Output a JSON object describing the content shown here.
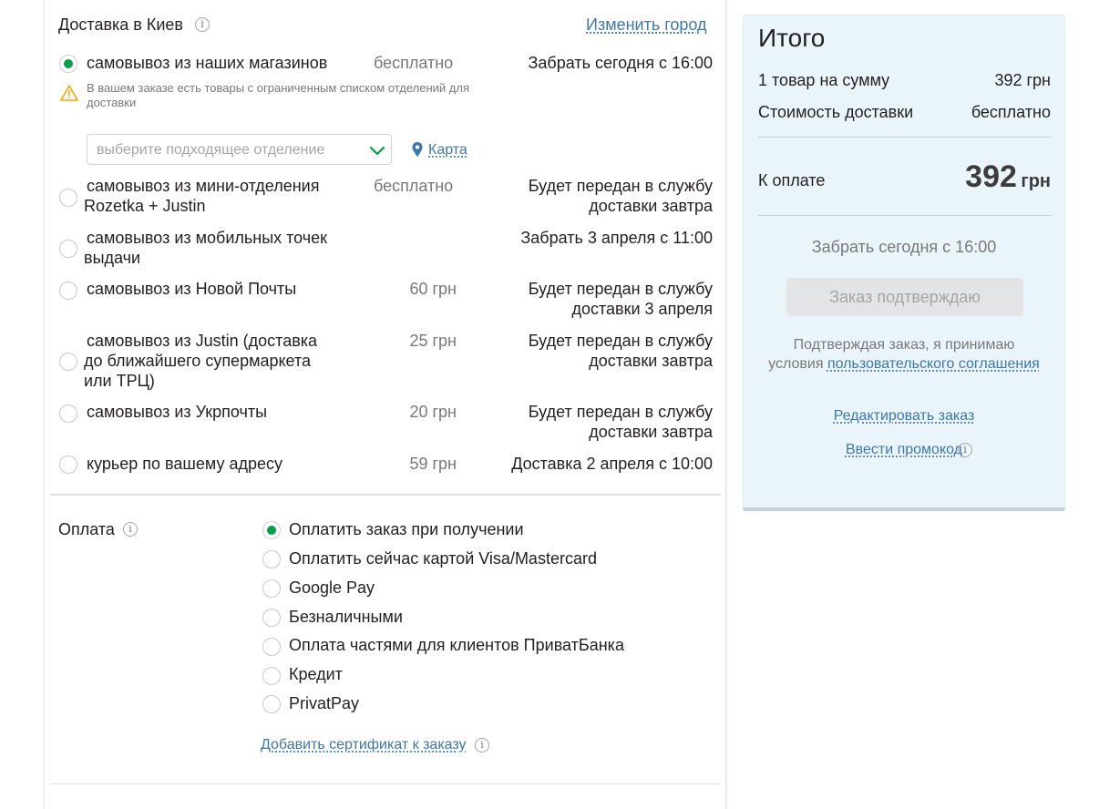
{
  "delivery": {
    "title": "Доставка в Киев",
    "change_city": "Изменить город",
    "options": [
      {
        "selected": true,
        "name_lines": [
          "самовывоз из наших магазинов"
        ],
        "price": "бесплатно",
        "when_lines": [
          "Забрать сегодня с 16:00"
        ]
      },
      {
        "selected": false,
        "name_lines": [
          "самовывоз из мини-отделения",
          "Rozetka + Justin"
        ],
        "price": "бесплатно",
        "when_lines": [
          "Будет передан в службу",
          "доставки завтра"
        ]
      },
      {
        "selected": false,
        "name_lines": [
          "самовывоз из мобильных точек",
          "выдачи"
        ],
        "price": "",
        "when_lines": [
          "Забрать 3 апреля с 11:00"
        ]
      },
      {
        "selected": false,
        "name_lines": [
          "самовывоз из Новой Почты"
        ],
        "price": "60 грн",
        "when_lines": [
          "Будет передан в службу",
          "доставки 3 апреля"
        ]
      },
      {
        "selected": false,
        "name_lines": [
          "самовывоз из Justin (доставка",
          "до ближайшего супермаркета",
          "или ТРЦ)"
        ],
        "price": "25 грн",
        "when_lines": [
          "Будет передан в службу",
          "доставки завтра"
        ]
      },
      {
        "selected": false,
        "name_lines": [
          "самовывоз из Укрпочты"
        ],
        "price": "20 грн",
        "when_lines": [
          "Будет передан в службу",
          "доставки завтра"
        ]
      },
      {
        "selected": false,
        "name_lines": [
          "курьер по вашему адресу"
        ],
        "price": "59 грн",
        "when_lines": [
          "Доставка 2 апреля с 10:00"
        ]
      }
    ],
    "warning_text": "В вашем заказе есть товары с ограниченным списком отделений для доставки",
    "branch_select_placeholder": "выберите подходящее отделение",
    "map_link": "Карта"
  },
  "payment": {
    "title": "Оплата",
    "options": [
      {
        "label": "Оплатить заказ при получении",
        "selected": true
      },
      {
        "label": "Оплатить сейчас картой Visa/Mastercard",
        "selected": false
      },
      {
        "label": "Google Pay",
        "selected": false
      },
      {
        "label": "Безналичными",
        "selected": false
      },
      {
        "label": "Оплата частями для клиентов ПриватБанка",
        "selected": false
      },
      {
        "label": "Кредит",
        "selected": false
      },
      {
        "label": "PrivatPay",
        "selected": false
      }
    ],
    "certificate_link": "Добавить сертификат к заказу"
  },
  "summary": {
    "title": "Итого",
    "items_label": "1 товар на сумму",
    "items_value": "392 грн",
    "delivery_label": "Стоимость доставки",
    "delivery_value": "бесплатно",
    "total_label": "К оплате",
    "total_amount": "392",
    "total_currency": "грн",
    "pickup_note": "Забрать сегодня с 16:00",
    "confirm_button": "Заказ подтверждаю",
    "terms_prefix": "Подтверждая заказ, я принимаю",
    "terms_conditions": "условия",
    "terms_link": "пользовательского соглашения",
    "edit_link": "Редактировать заказ",
    "promo_link": "Ввести промокод"
  },
  "colors": {
    "accent_green": "#00a046",
    "link_blue": "#3e77aa",
    "summary_bg": "#eaf5fb",
    "warning_yellow": "#f8a300"
  },
  "icons": {
    "info": "info-icon",
    "warning": "warning-icon",
    "chevron": "chevron-down-icon",
    "map": "map-pin-icon"
  }
}
